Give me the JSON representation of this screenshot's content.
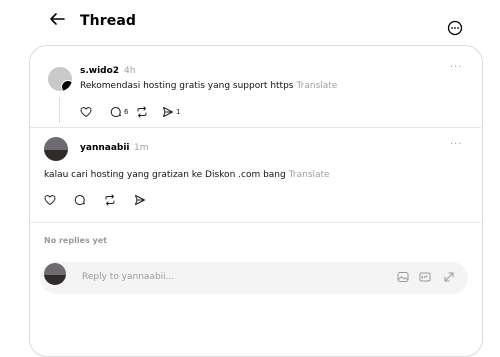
{
  "header": {
    "title": "Thread"
  },
  "post": {
    "username": "s.wido2",
    "time": "4h",
    "text": "Rekomendasi hosting gratis yang support https",
    "translate": "Translate",
    "replies": "6",
    "shares": "1"
  },
  "reply": {
    "username": "yannaabii",
    "time": "1m",
    "text": "kalau cari hosting yang gratizan ke Diskon .com bang",
    "translate": "Translate"
  },
  "no_replies": "No replies yet",
  "composer": {
    "placeholder": "Reply to yannaabii..."
  },
  "icons": [
    "back-arrow-icon",
    "more-circle-icon",
    "like-icon",
    "comment-icon",
    "repost-icon",
    "share-icon",
    "image-icon",
    "gif-icon",
    "expand-icon"
  ]
}
